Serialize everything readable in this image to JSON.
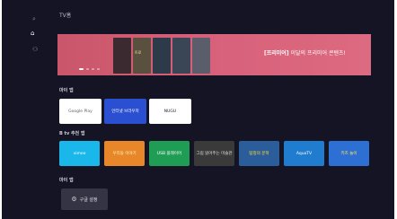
{
  "header": {
    "title": "TV홈"
  },
  "sidebar": {
    "items": [
      {
        "icon": "search-icon",
        "glyph": "⌕"
      },
      {
        "icon": "home-icon",
        "glyph": "⌂"
      },
      {
        "icon": "user-icon",
        "glyph": "⚇"
      }
    ]
  },
  "banner": {
    "tag": "[프리미어]",
    "text": "이달의 프리미어 콘텐츠!",
    "poster_text": "트로"
  },
  "sections": {
    "my_apps": "마이 앱",
    "recommended": "B tv 추천 앱",
    "more": "마이 앱"
  },
  "my_apps": [
    {
      "label": "Google Play",
      "bg": "#ffffff",
      "color": "#5f6368"
    },
    {
      "label": "인터넷 브라우저",
      "bg": "#2a4fd0",
      "color": "#ffffff"
    },
    {
      "label": "NUGU",
      "bg": "#ffffff",
      "color": "#1a1a2e"
    }
  ],
  "recommended_apps": [
    {
      "label": "vimeo",
      "bg": "#1ab7ea",
      "color": "#ffffff"
    },
    {
      "label": "우리들 이야기",
      "bg": "#e8862a",
      "color": "#fff4c0"
    },
    {
      "label": "USB 플레이어",
      "bg": "#1f9d55",
      "color": "#ffffff"
    },
    {
      "label": "그림 읽어주는 미술관",
      "bg": "#3a3a3a",
      "color": "#e0e0e0"
    },
    {
      "label": "탐정의 문학",
      "bg": "#2b5d9a",
      "color": "#ffe23a"
    },
    {
      "label": "AquaTV",
      "bg": "#1f7ccf",
      "color": "#ffffff"
    },
    {
      "label": "키즈 놀이",
      "bg": "#2e6fd4",
      "color": "#ffe95c"
    }
  ],
  "settings": {
    "label": "구글 설정",
    "icon": "gear-icon"
  }
}
